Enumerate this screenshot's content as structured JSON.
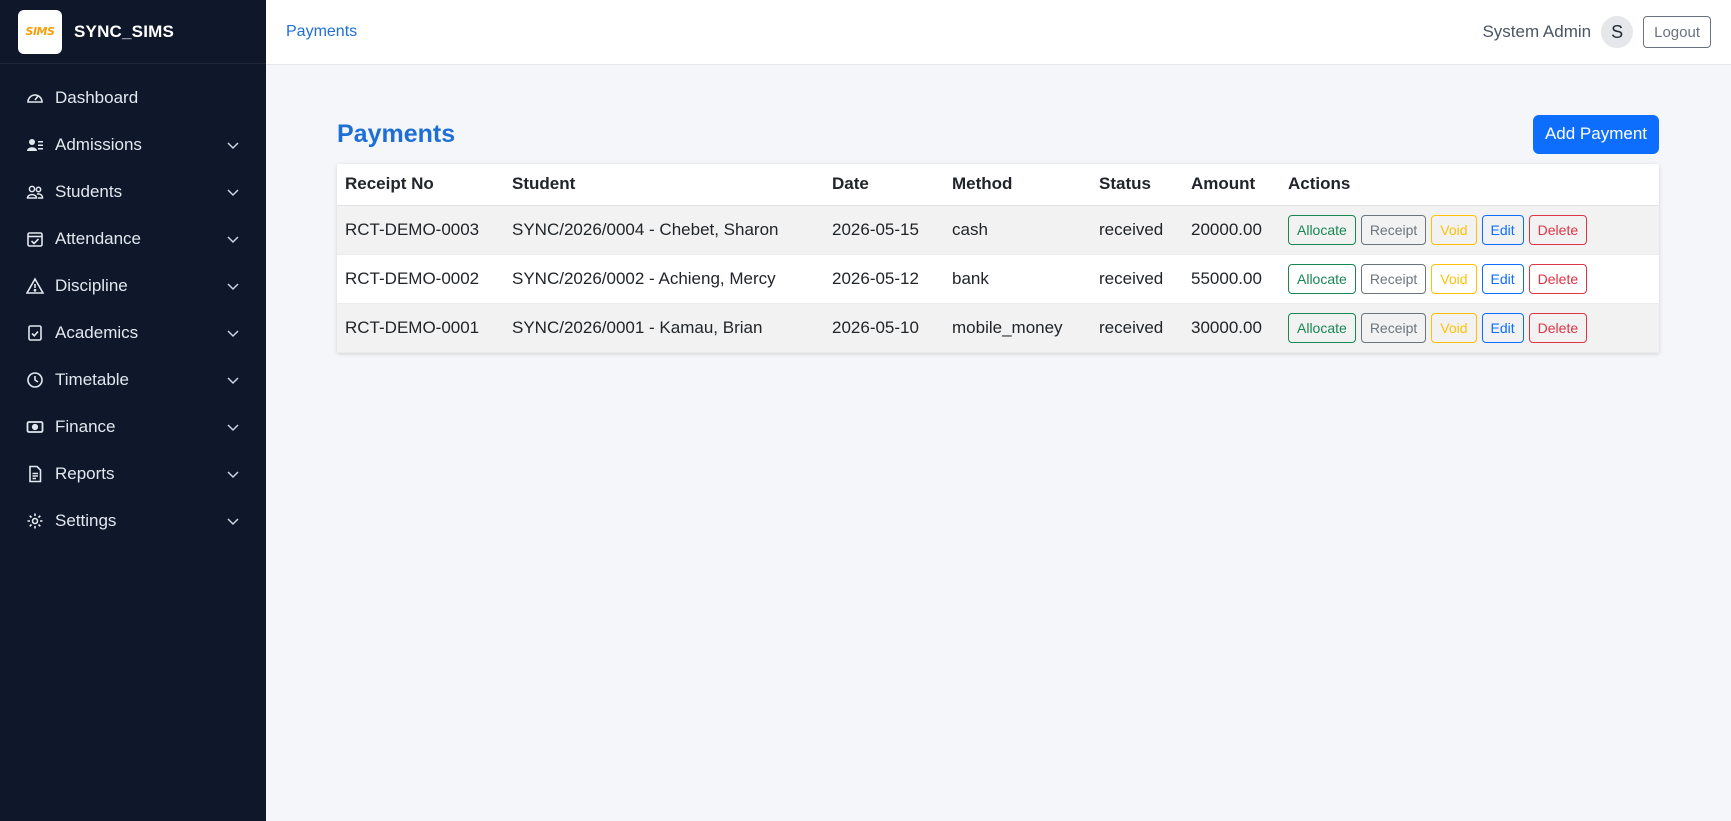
{
  "brand": {
    "logo_text": "SIMS",
    "name": "SYNC_SIMS"
  },
  "sidebar": {
    "items": [
      {
        "label": "Dashboard",
        "icon": "gauge-icon",
        "expandable": false
      },
      {
        "label": "Admissions",
        "icon": "user-plus-icon",
        "expandable": true
      },
      {
        "label": "Students",
        "icon": "users-icon",
        "expandable": true
      },
      {
        "label": "Attendance",
        "icon": "calendar-check-icon",
        "expandable": true
      },
      {
        "label": "Discipline",
        "icon": "warning-triangle-icon",
        "expandable": true
      },
      {
        "label": "Academics",
        "icon": "clipboard-check-icon",
        "expandable": true
      },
      {
        "label": "Timetable",
        "icon": "clock-icon",
        "expandable": true
      },
      {
        "label": "Finance",
        "icon": "cash-icon",
        "expandable": true
      },
      {
        "label": "Reports",
        "icon": "document-icon",
        "expandable": true
      },
      {
        "label": "Settings",
        "icon": "gear-icon",
        "expandable": true
      }
    ]
  },
  "topbar": {
    "breadcrumb": "Payments",
    "user_name": "System Admin",
    "avatar_initial": "S",
    "logout_label": "Logout"
  },
  "main": {
    "title": "Payments",
    "add_button_label": "Add Payment",
    "table": {
      "columns": [
        "Receipt No",
        "Student",
        "Date",
        "Method",
        "Status",
        "Amount",
        "Actions"
      ],
      "rows": [
        {
          "receipt": "RCT-DEMO-0003",
          "student": "SYNC/2026/0004 - Chebet, Sharon",
          "date": "2026-05-15",
          "method": "cash",
          "status": "received",
          "amount": "20000.00"
        },
        {
          "receipt": "RCT-DEMO-0002",
          "student": "SYNC/2026/0002 - Achieng, Mercy",
          "date": "2026-05-12",
          "method": "bank",
          "status": "received",
          "amount": "55000.00"
        },
        {
          "receipt": "RCT-DEMO-0001",
          "student": "SYNC/2026/0001 - Kamau, Brian",
          "date": "2026-05-10",
          "method": "mobile_money",
          "status": "received",
          "amount": "30000.00"
        }
      ],
      "actions": [
        "Allocate",
        "Receipt",
        "Void",
        "Edit",
        "Delete"
      ]
    }
  },
  "colors": {
    "sidebar_bg": "#0f172a",
    "accent": "#1d6fd6",
    "primary_button": "#0d6efd",
    "allocate": "#198754",
    "receipt": "#6c757d",
    "void": "#ffc107",
    "edit": "#0d6efd",
    "delete": "#dc3545"
  }
}
